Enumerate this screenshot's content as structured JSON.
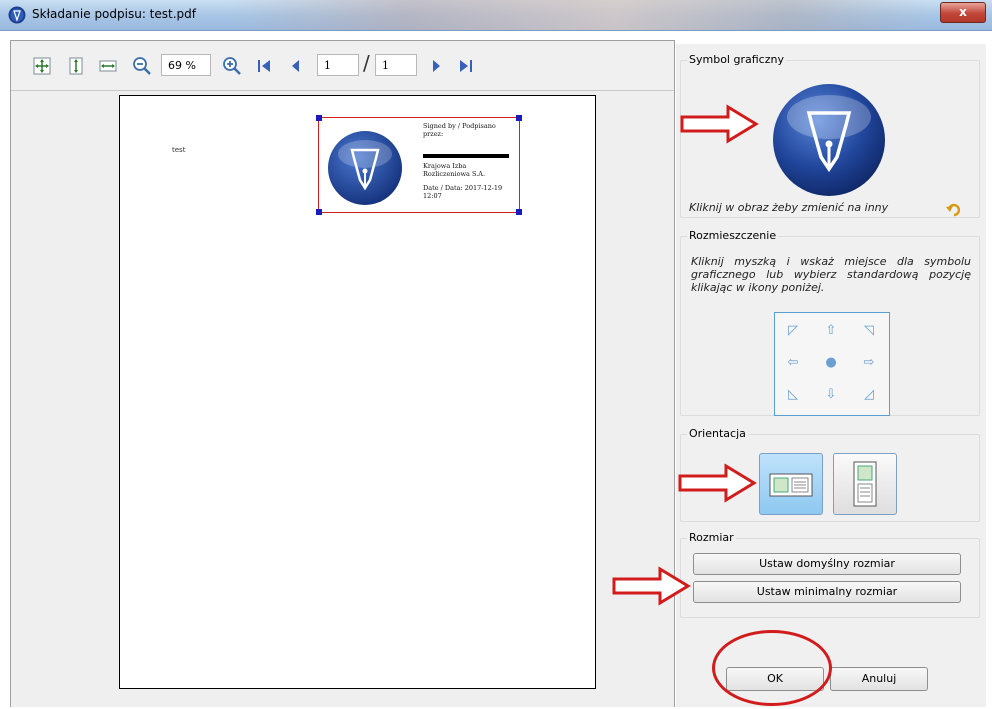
{
  "window": {
    "title": "Składanie podpisu: test.pdf",
    "close_label": "x"
  },
  "toolbar": {
    "zoom_value": "69 %",
    "page_current": "1",
    "page_total": "1",
    "icons": [
      "fit-page-icon",
      "fit-height-icon",
      "fit-width-icon",
      "zoom-out-icon",
      "zoom-in-icon",
      "first-page-icon",
      "prev-page-icon",
      "next-page-icon",
      "last-page-icon"
    ]
  },
  "preview": {
    "page_text": "test",
    "signature": {
      "line1": "Signed by / Podpisano",
      "line2": "przez:",
      "line3": "Krajowa Izba",
      "line4": "Rozliczeniowa S.A.",
      "line5": "Date / Data: 2017-12-19",
      "line6": "12:07"
    }
  },
  "symbol_group": {
    "title": "Symbol graficzny",
    "note": "Kliknij w obraz żeby zmienić na inny"
  },
  "placement_group": {
    "title": "Rozmieszczenie",
    "note": "Kliknij myszką i wskaż miejsce dla symbolu graficznego lub wybierz standardową pozycję klikając w ikony poniżej."
  },
  "orientation_group": {
    "title": "Orientacja"
  },
  "size_group": {
    "title": "Rozmiar",
    "default_size_label": "Ustaw domyślny rozmiar",
    "min_size_label": "Ustaw minimalny rozmiar"
  },
  "footer": {
    "ok_label": "OK",
    "cancel_label": "Anuluj"
  },
  "colors": {
    "annotation_red": "#d21c1c",
    "selection_blue": "#1a1ac0",
    "logo_blue": "#1c3f8f"
  }
}
